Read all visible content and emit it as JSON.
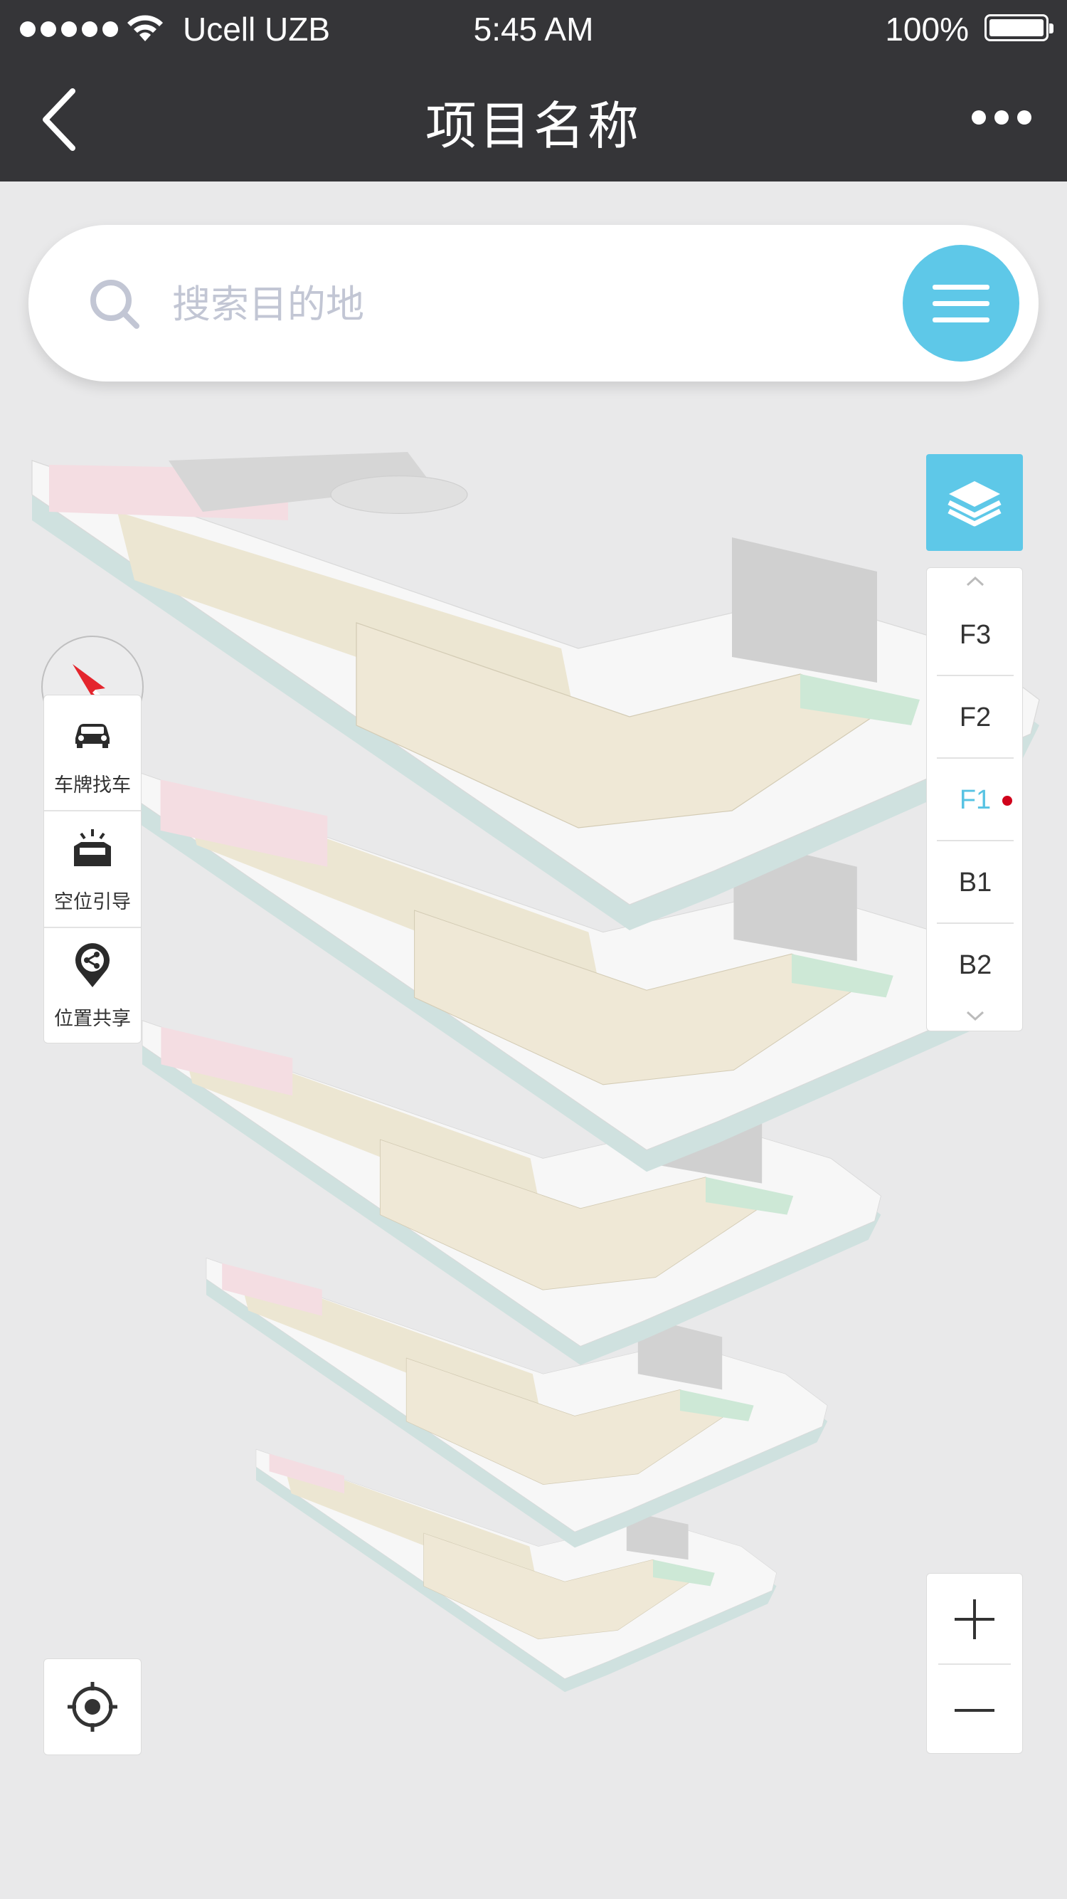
{
  "status_bar": {
    "carrier": "Ucell UZB",
    "time": "5:45 AM",
    "battery": "100%"
  },
  "nav": {
    "title": "项目名称",
    "back_icon": "chevron-left-icon",
    "more_icon": "more-dots-icon"
  },
  "search": {
    "placeholder": "搜索目的地",
    "icon": "search-icon",
    "menu_icon": "hamburger-menu-icon"
  },
  "floor_selector": {
    "layer_icon": "layers-icon",
    "floors": [
      "F3",
      "F2",
      "F1",
      "B1",
      "B2"
    ],
    "active": "F1"
  },
  "tools": [
    {
      "label": "车牌找车",
      "icon": "car-icon"
    },
    {
      "label": "空位引导",
      "icon": "parking-space-icon"
    },
    {
      "label": "位置共享",
      "icon": "location-share-icon"
    }
  ],
  "zoom": {
    "in_icon": "plus-icon",
    "out_icon": "minus-icon"
  },
  "locate": {
    "icon": "locate-crosshair-icon"
  },
  "colors": {
    "accent": "#5ec8e8",
    "nav_bg": "#353538",
    "active_dot": "#d0021b",
    "map_bg": "#e9e9ea"
  }
}
